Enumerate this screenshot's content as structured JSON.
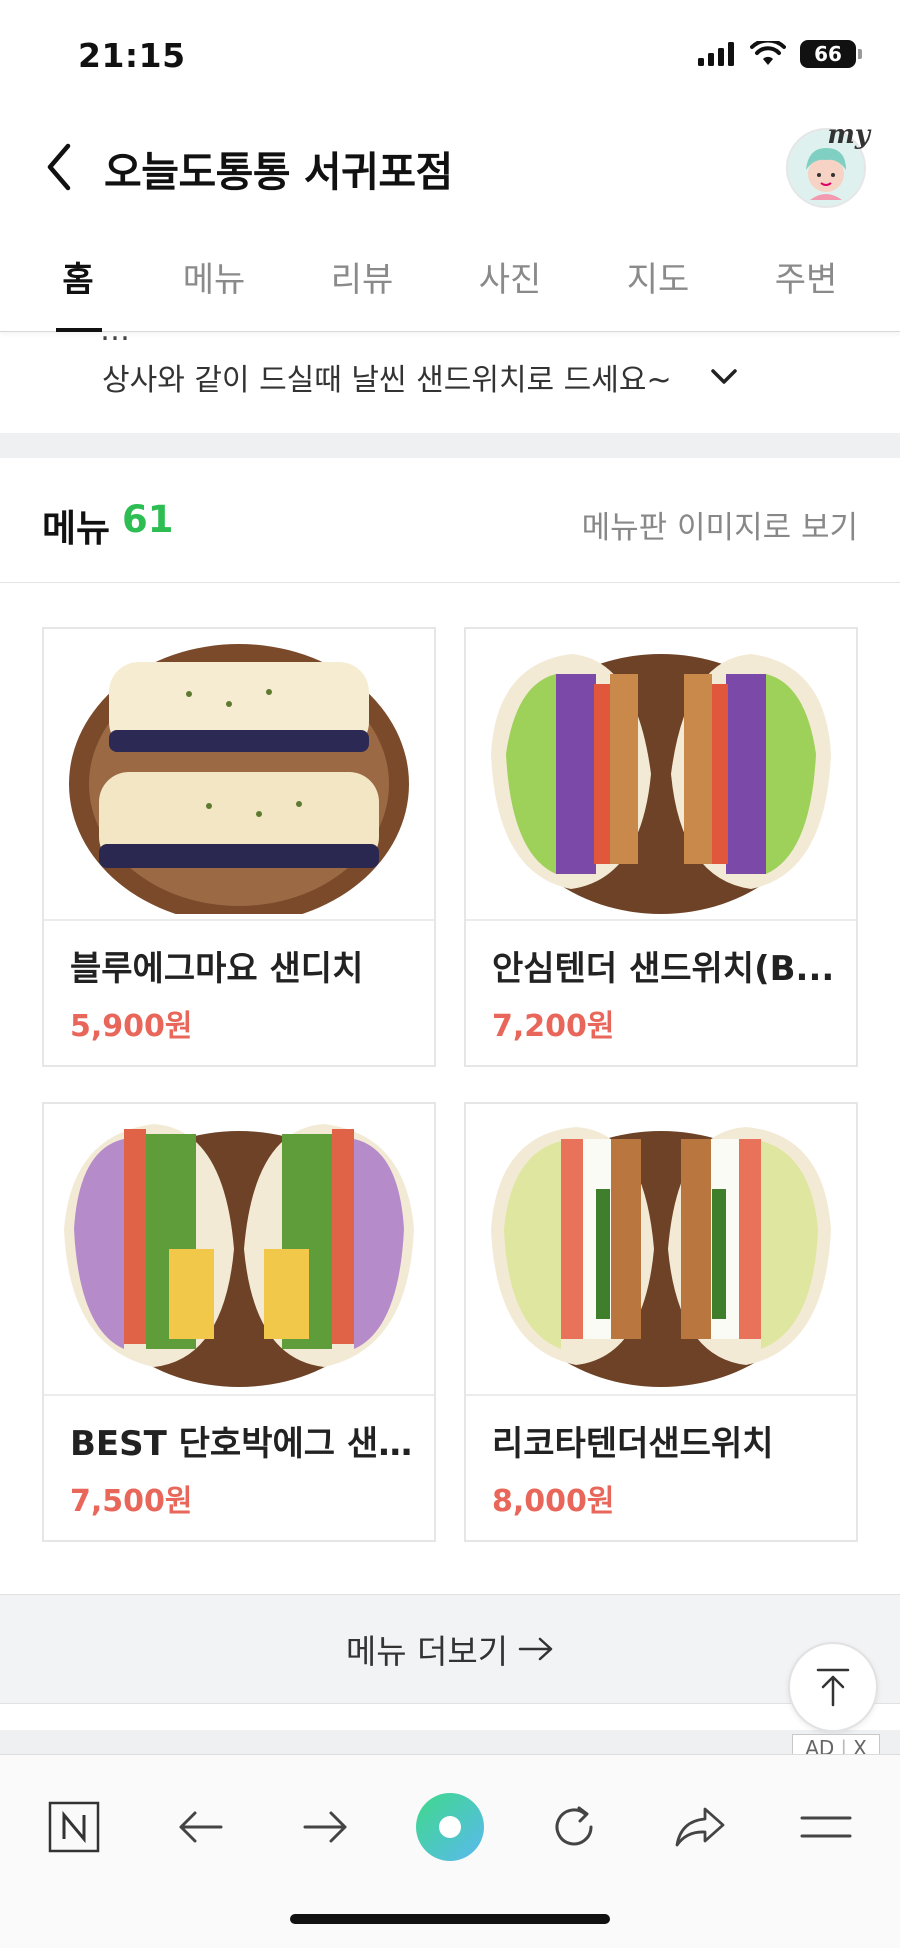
{
  "status_bar": {
    "time": "21:15",
    "battery": "66"
  },
  "header": {
    "title": "오늘도통통 서귀포점",
    "avatar_label": "my"
  },
  "tabs": [
    {
      "label": "홈",
      "active": true
    },
    {
      "label": "메뉴",
      "active": false
    },
    {
      "label": "리뷰",
      "active": false
    },
    {
      "label": "사진",
      "active": false
    },
    {
      "label": "지도",
      "active": false
    },
    {
      "label": "주변",
      "active": false
    }
  ],
  "intro": {
    "cut_line": "…",
    "text": "상사와 같이 드실때 날씬 샌드위치로 드세요~"
  },
  "menu": {
    "title": "메뉴",
    "count": "61",
    "image_link": "메뉴판 이미지로 보기",
    "items": [
      {
        "name": "블루에그마요 샌디치",
        "price": "5,900원",
        "icon": "sandwich-photo"
      },
      {
        "name": "안심텐더 샌드위치(B...",
        "price": "7,200원",
        "icon": "sandwich-photo"
      },
      {
        "name": "BEST 단호박에그 샌...",
        "price": "7,500원",
        "icon": "sandwich-photo"
      },
      {
        "name": "리코타텐더샌드위치",
        "price": "8,000원",
        "icon": "sandwich-photo"
      }
    ],
    "more_label": "메뉴 더보기"
  },
  "ad": {
    "label": "AD",
    "close": "X"
  },
  "bottom_bar": {
    "icons": [
      "naver-n-icon",
      "back-arrow-icon",
      "forward-arrow-icon",
      "green-dot-icon",
      "refresh-icon",
      "share-icon",
      "menu-icon"
    ]
  },
  "colors": {
    "accent_green": "#2dbd52",
    "price_red": "#e8665a"
  }
}
